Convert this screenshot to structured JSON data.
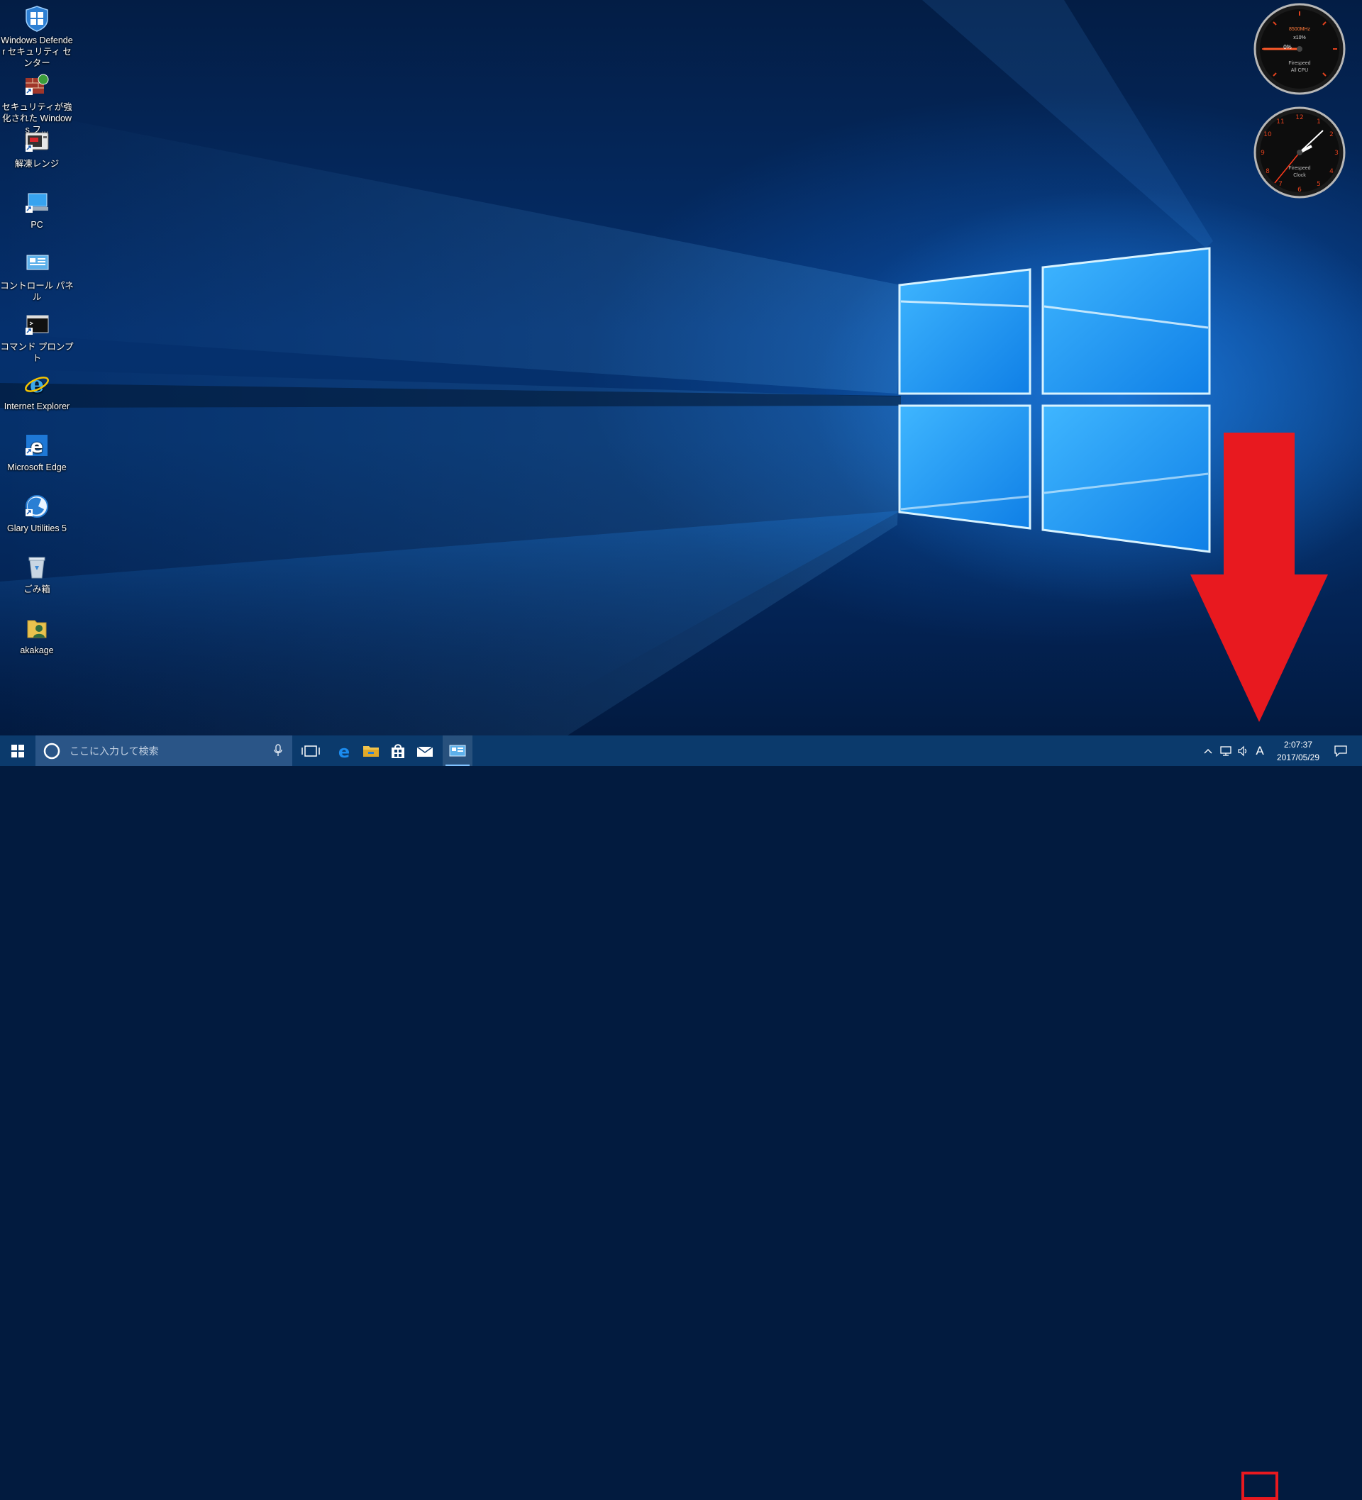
{
  "desktop": {
    "icons": [
      {
        "label": "Windows Defender セキュリティ センター",
        "icon": "windows-defender-icon"
      },
      {
        "label": "セキュリティが強化された Windows フ...",
        "icon": "firewall-icon"
      },
      {
        "label": "解凍レンジ",
        "icon": "decompress-range-icon"
      },
      {
        "label": "PC",
        "icon": "pc-icon"
      },
      {
        "label": "コントロール パネル",
        "icon": "control-panel-icon"
      },
      {
        "label": "コマンド プロンプト",
        "icon": "command-prompt-icon"
      },
      {
        "label": "Internet Explorer",
        "icon": "internet-explorer-icon"
      },
      {
        "label": "Microsoft Edge",
        "icon": "edge-icon"
      },
      {
        "label": "Glary Utilities 5",
        "icon": "glary-utilities-icon"
      },
      {
        "label": "ごみ箱",
        "icon": "recycle-bin-icon"
      },
      {
        "label": "akakage",
        "icon": "user-folder-icon"
      }
    ]
  },
  "gadgets": {
    "cpu_meter": {
      "freq": "8500MHz",
      "multiplier": "x10%",
      "percent": "0%",
      "title": "Firespeed",
      "subtitle": "All CPU"
    },
    "clock": {
      "title": "Firespeed",
      "subtitle": "Clock"
    }
  },
  "taskbar": {
    "search_placeholder": "ここに入力して検索",
    "pinned": [
      "task-view-icon",
      "edge-icon",
      "file-explorer-icon",
      "store-icon",
      "mail-icon",
      "control-panel-icon"
    ],
    "ime_indicator": "A",
    "time": "2:07:37",
    "date": "2017/05/29"
  },
  "colors": {
    "annotation_red": "#e8191f",
    "taskbar": "#0b3a6c",
    "accent": "#1e90ff"
  }
}
